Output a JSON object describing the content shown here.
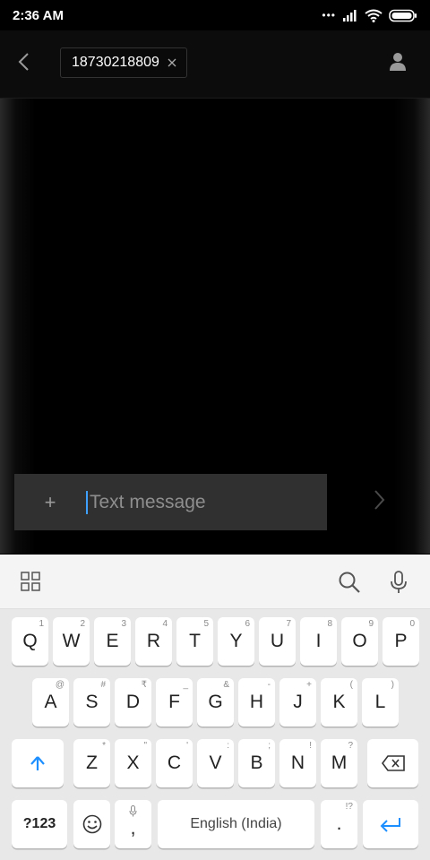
{
  "status_bar": {
    "time": "2:36 AM",
    "dots": "•••"
  },
  "header": {
    "recipient": "18730218809"
  },
  "compose": {
    "placeholder": "Text message",
    "value": "",
    "plus_label": "+"
  },
  "keyboard": {
    "row1": [
      {
        "label": "Q",
        "hint": "1"
      },
      {
        "label": "W",
        "hint": "2"
      },
      {
        "label": "E",
        "hint": "3"
      },
      {
        "label": "R",
        "hint": "4"
      },
      {
        "label": "T",
        "hint": "5"
      },
      {
        "label": "Y",
        "hint": "6"
      },
      {
        "label": "U",
        "hint": "7"
      },
      {
        "label": "I",
        "hint": "8"
      },
      {
        "label": "O",
        "hint": "9"
      },
      {
        "label": "P",
        "hint": "0"
      }
    ],
    "row2": [
      {
        "label": "A",
        "hint": "@"
      },
      {
        "label": "S",
        "hint": "#"
      },
      {
        "label": "D",
        "hint": "₹"
      },
      {
        "label": "F",
        "hint": "_"
      },
      {
        "label": "G",
        "hint": "&"
      },
      {
        "label": "H",
        "hint": "-"
      },
      {
        "label": "J",
        "hint": "+"
      },
      {
        "label": "K",
        "hint": "("
      },
      {
        "label": "L",
        "hint": ")"
      }
    ],
    "row3": [
      {
        "label": "Z",
        "hint": "*"
      },
      {
        "label": "X",
        "hint": "\""
      },
      {
        "label": "C",
        "hint": "'"
      },
      {
        "label": "V",
        "hint": ":"
      },
      {
        "label": "B",
        "hint": ";"
      },
      {
        "label": "N",
        "hint": "!"
      },
      {
        "label": "M",
        "hint": "?"
      }
    ],
    "symbols_label": "?123",
    "comma_label": ",",
    "space_label": "English (India)",
    "period_label": ".",
    "period_hint": "!?"
  },
  "colors": {
    "accent": "#3fa0ff",
    "keyboard_bg": "#e8e8e8",
    "compose_bg": "#303030"
  }
}
